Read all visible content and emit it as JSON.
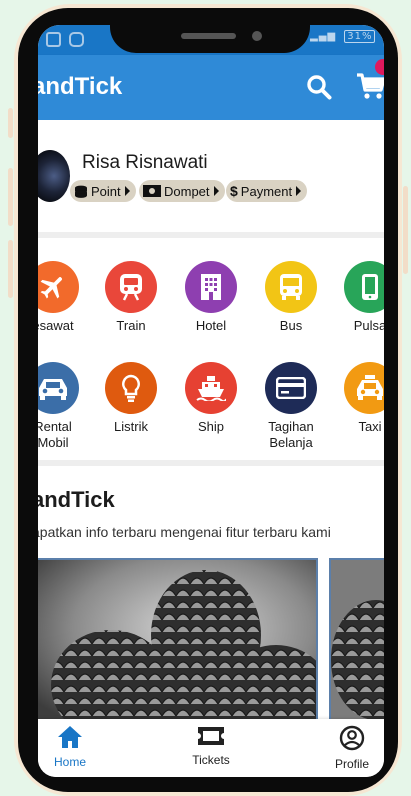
{
  "app_bar": {
    "title": "andTick"
  },
  "profile": {
    "name": "Risa Risnawati",
    "chips": [
      {
        "label": "Point",
        "icon": "coins-icon"
      },
      {
        "label": "Dompet",
        "icon": "money-icon"
      },
      {
        "label": "Payment",
        "icon": "dollar-icon"
      }
    ]
  },
  "services": [
    {
      "label": "esawat",
      "color": "#f26a2b",
      "icon": "plane-icon"
    },
    {
      "label": "Train",
      "color": "#e9473a",
      "icon": "train-icon"
    },
    {
      "label": "Hotel",
      "color": "#8e3fb0",
      "icon": "hotel-icon"
    },
    {
      "label": "Bus",
      "color": "#f2c515",
      "icon": "bus-icon"
    },
    {
      "label": "Pulsa",
      "color": "#28a559",
      "icon": "phone-icon"
    },
    {
      "label": "Rental\nMobil",
      "color": "#3b6ea8",
      "icon": "car-icon"
    },
    {
      "label": "Listrik",
      "color": "#df5a0f",
      "icon": "bulb-icon"
    },
    {
      "label": "Ship",
      "color": "#e64132",
      "icon": "ship-icon"
    },
    {
      "label": "Tagihan\nBelanja",
      "color": "#1e2b57",
      "icon": "card-icon"
    },
    {
      "label": "Taxi",
      "color": "#f29a12",
      "icon": "taxi-icon"
    }
  ],
  "news": {
    "title": "andTick",
    "subtitle": "apatkan info terbaru mengenai fitur terbaru kami"
  },
  "bottom_nav": [
    {
      "label": "Home",
      "active": true
    },
    {
      "label": "Tickets",
      "active": false
    },
    {
      "label": "Profile",
      "active": false
    }
  ],
  "colors": {
    "primary": "#2f8ad7",
    "status_bar": "#1976c6",
    "active_nav": "#1976c6"
  },
  "status_bar": {
    "battery": "31%"
  }
}
